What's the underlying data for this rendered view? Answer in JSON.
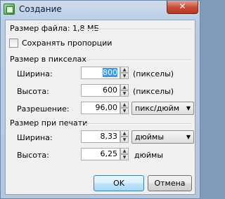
{
  "window": {
    "title": "Создание",
    "close_symbol": "✕"
  },
  "file_size_label": "Размер файла: 1,8 МБ",
  "keep_proportions": {
    "label": "Сохранять пропорции",
    "checked": false
  },
  "pixel_size": {
    "section_label": "Размер в пикселах",
    "width": {
      "label": "Ширина:",
      "value": "800",
      "unit": "(пикселы)"
    },
    "height": {
      "label": "Высота:",
      "value": "600",
      "unit": "(пикселы)"
    },
    "resolution": {
      "label": "Разрешение:",
      "value": "96,00",
      "unit_selected": "пикс/дюйм"
    }
  },
  "print_size": {
    "section_label": "Размер при печати",
    "width": {
      "label": "Ширина:",
      "value": "8,33",
      "unit_selected": "дюймы"
    },
    "height": {
      "label": "Высота:",
      "value": "6,25",
      "unit": "дюймы"
    }
  },
  "buttons": {
    "ok": "OK",
    "cancel": "Отмена"
  },
  "icons": {
    "spin_up": "▲",
    "spin_down": "▼",
    "dropdown": "▼"
  }
}
